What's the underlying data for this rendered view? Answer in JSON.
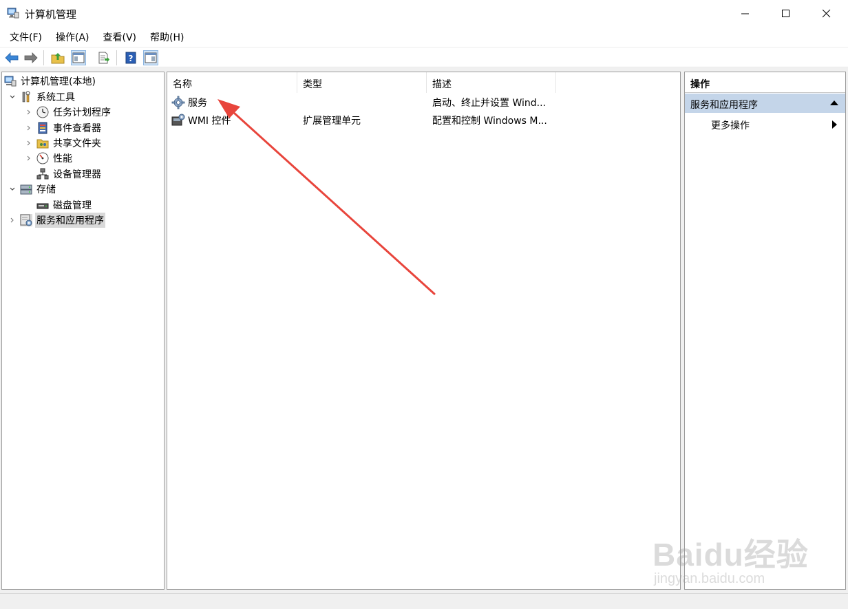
{
  "window": {
    "title": "计算机管理",
    "minimize_icon": "minimize-icon",
    "maximize_icon": "maximize-icon",
    "close_icon": "close-icon"
  },
  "menu": [
    {
      "label": "文件(F)"
    },
    {
      "label": "操作(A)"
    },
    {
      "label": "查看(V)"
    },
    {
      "label": "帮助(H)"
    }
  ],
  "toolbar": {
    "buttons": [
      "back-arrow-icon",
      "forward-arrow-icon",
      "up-folder-icon",
      "show-hide-tree-icon",
      "export-list-icon",
      "help-icon",
      "show-hide-action-pane-icon"
    ]
  },
  "tree": {
    "items": [
      {
        "label": "计算机管理(本地)",
        "icon": "computer-management-icon"
      },
      {
        "label": "系统工具",
        "icon": "tools-icon"
      },
      {
        "label": "任务计划程序",
        "icon": "clock-icon"
      },
      {
        "label": "事件查看器",
        "icon": "event-viewer-icon"
      },
      {
        "label": "共享文件夹",
        "icon": "shared-folder-icon"
      },
      {
        "label": "性能",
        "icon": "performance-icon"
      },
      {
        "label": "设备管理器",
        "icon": "device-manager-icon"
      },
      {
        "label": "存储",
        "icon": "storage-icon"
      },
      {
        "label": "磁盘管理",
        "icon": "disk-icon"
      },
      {
        "label": "服务和应用程序",
        "icon": "services-apps-icon"
      }
    ]
  },
  "list": {
    "columns": {
      "name": "名称",
      "type": "类型",
      "desc": "描述"
    },
    "rows": [
      {
        "name": "服务",
        "type": "",
        "desc": "启动、终止并设置 Wind...",
        "icon": "gear-icon"
      },
      {
        "name": "WMI 控件",
        "type": "扩展管理单元",
        "desc": "配置和控制 Windows M...",
        "icon": "wmi-control-icon"
      }
    ]
  },
  "actions": {
    "title": "操作",
    "section": "服务和应用程序",
    "more": "更多操作"
  },
  "watermark": {
    "brand": "Baidu经验",
    "url": "jingyan.baidu.com"
  },
  "colors": {
    "selection": "#d9d9d9",
    "action_section": "#c4d5e9",
    "annotation": "#e8453c"
  }
}
